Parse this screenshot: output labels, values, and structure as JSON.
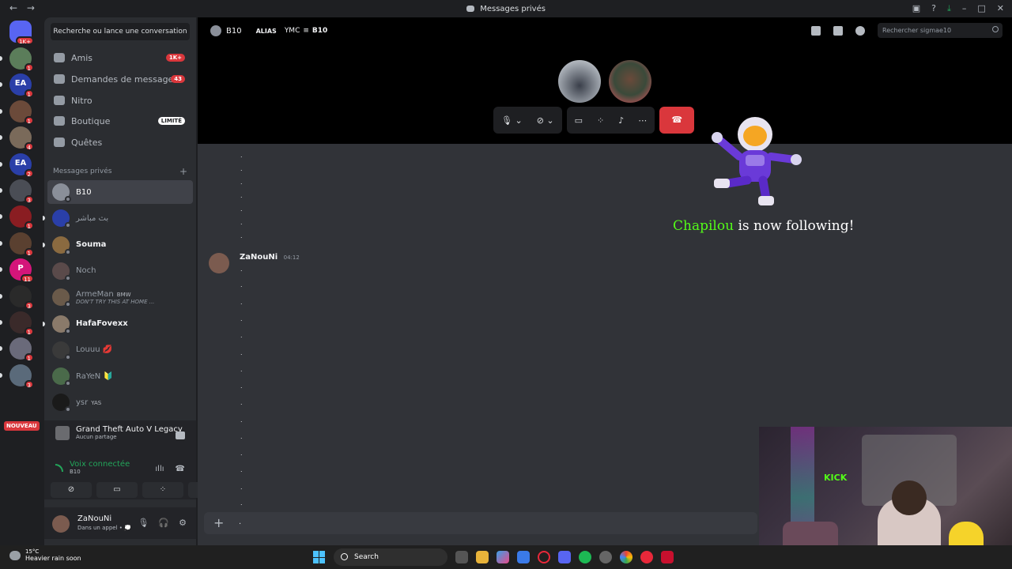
{
  "window": {
    "title": "Messages privés",
    "back": "←",
    "forward": "→"
  },
  "servers": {
    "home_badge": "1K+",
    "items": [
      {
        "badge": "1",
        "color": "#5b7d5a"
      },
      {
        "badge": "1",
        "color": "#2a3fa8",
        "label": "EA"
      },
      {
        "badge": "1",
        "color": "#6b4a3a"
      },
      {
        "badge": "4",
        "color": "#7a6a5a"
      },
      {
        "badge": "2",
        "color": "#2a3fa8",
        "label": "EA"
      },
      {
        "badge": "3",
        "color": "#4a4d55"
      },
      {
        "badge": "1",
        "color": "#8a1d22"
      },
      {
        "badge": "1",
        "color": "#5a4030"
      },
      {
        "badge": "11",
        "color": "#d4157a",
        "label": "P"
      },
      {
        "badge": "3",
        "color": "#2a2a2a"
      },
      {
        "badge": "1",
        "color": "#3a2a2a"
      },
      {
        "badge": "1",
        "color": "#6a6a7a"
      },
      {
        "badge": "3",
        "color": "#5a6a7a"
      }
    ],
    "nouveau": "NOUVEAU"
  },
  "sidebar": {
    "search": "Recherche ou lance une conversation",
    "nav": [
      {
        "label": "Amis",
        "badge": "1K+"
      },
      {
        "label": "Demandes de message",
        "badge": "43"
      },
      {
        "label": "Nitro"
      },
      {
        "label": "Boutique",
        "badge": "LIMITÉ"
      },
      {
        "label": "Quêtes"
      }
    ],
    "section_title": "Messages privés",
    "section_plus": "+",
    "dms": [
      {
        "name": "B10",
        "color": "#8a8f99"
      },
      {
        "name": "بث مباشر",
        "color": "#2a3fa8"
      },
      {
        "name": "Souma",
        "color": "#8a6a40"
      },
      {
        "name": "Noch",
        "color": "#5a4a4a"
      },
      {
        "name": "ArmeMan",
        "tag": "BMW",
        "sub": "DON'T TRY THIS AT HOME ...",
        "color": "#6a5a4a"
      },
      {
        "name": "HafaFovexx",
        "color": "#8a7a6a"
      },
      {
        "name": "Louuu 💋",
        "color": "#3a3a3a"
      },
      {
        "name": "RaYeN 🔰",
        "color": "#4a6a4a"
      },
      {
        "name": "ysr",
        "tag": "YAS",
        "color": "#1a1a1a"
      }
    ]
  },
  "activity": {
    "game": "Grand Theft Auto V Legacy",
    "game_sub": "Aucun partage",
    "voice": "Voix connectée",
    "voice_channel": "B10"
  },
  "user": {
    "name": "ZaNouNi",
    "status": "Dans un appel • 💭"
  },
  "header": {
    "name": "B10",
    "alias_label": "ALIAS",
    "alias_value": "YMC",
    "alias_sep": "≡",
    "alias_name": "B10",
    "search_placeholder": "Rechercher sigmae10"
  },
  "message": {
    "author": "ZaNouNi",
    "time": "04:12",
    "dot": "."
  },
  "composer": {
    "plus": "+",
    "text": "."
  },
  "overlay": {
    "follower": "Chapilou",
    "text": "is now following!",
    "kick": "KICK"
  },
  "taskbar": {
    "temp": "15°C",
    "weather": "Heavier rain soon",
    "search": "Search"
  }
}
